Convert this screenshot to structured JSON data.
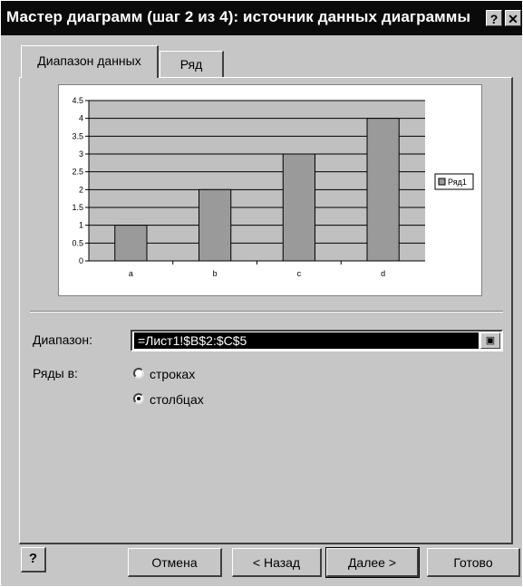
{
  "window": {
    "title": "Мастер диаграмм (шаг 2 из 4): источник данных диаграммы",
    "help_glyph": "?",
    "close_glyph": "✕"
  },
  "tabs": [
    {
      "label": "Диапазон данных",
      "active": true
    },
    {
      "label": "Ряд",
      "active": false
    }
  ],
  "chart_data": {
    "type": "bar",
    "categories": [
      "a",
      "b",
      "c",
      "d"
    ],
    "series": [
      {
        "name": "Ряд1",
        "values": [
          1,
          2,
          3,
          4
        ]
      }
    ],
    "ylim": [
      0,
      4.5
    ],
    "yticks": [
      "0",
      "0.5",
      "1",
      "1.5",
      "2",
      "2.5",
      "3",
      "3.5",
      "4",
      "4.5"
    ],
    "grid": true,
    "legend": "right",
    "bar_color": "#9a9a9a"
  },
  "range": {
    "label": "Диапазон:",
    "value": "=Лист1!$B$2:$C$5",
    "button_icon": "collapse-dialog-icon"
  },
  "series_in": {
    "label": "Ряды в:",
    "options": [
      {
        "label": "строках",
        "selected": false
      },
      {
        "label": "столбцах",
        "selected": true
      }
    ]
  },
  "buttons": {
    "help": "?",
    "cancel": "Отмена",
    "back": "< Назад",
    "next": "Далее >",
    "finish": "Готово"
  }
}
